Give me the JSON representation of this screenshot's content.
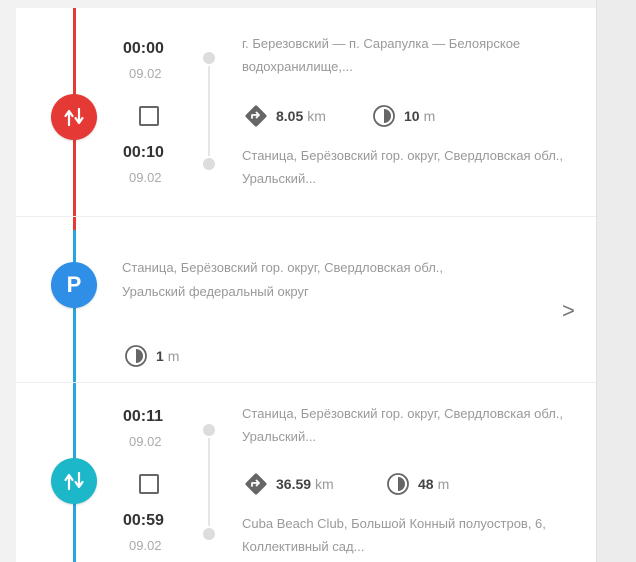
{
  "colors": {
    "drive": "#e53935",
    "parking": "#2f8ee6",
    "drive2": "#1cb8c9",
    "rail_red": "#e53935",
    "rail_blue": "#2aa4e0"
  },
  "trip1": {
    "icon": "route-arrows-icon",
    "start_time": "00:00",
    "start_date": "09.02",
    "end_time": "00:10",
    "end_date": "09.02",
    "from": "г. Березовский — п. Сарапулка — Белоярское водохранилище,...",
    "to": "Станица, Берёзовский гор. округ, Свердловская обл., Уральский...",
    "distance": "8.05",
    "distance_unit": "km",
    "duration": "10",
    "duration_unit": "m"
  },
  "parking": {
    "icon_letter": "P",
    "address": "Станица, Берёзовский гор. округ, Свердловская обл., Уральский федеральный округ",
    "duration": "1",
    "duration_unit": "m",
    "chevron": ">"
  },
  "trip2": {
    "icon": "route-arrows-icon",
    "start_time": "00:11",
    "start_date": "09.02",
    "end_time": "00:59",
    "end_date": "09.02",
    "from": "Станица, Берёзовский гор. округ, Свердловская обл., Уральский...",
    "to": "Cuba Beach Club, Большой Конный полуостров, 6, Коллективный сад...",
    "distance": "36.59",
    "distance_unit": "km",
    "duration": "48",
    "duration_unit": "m"
  }
}
